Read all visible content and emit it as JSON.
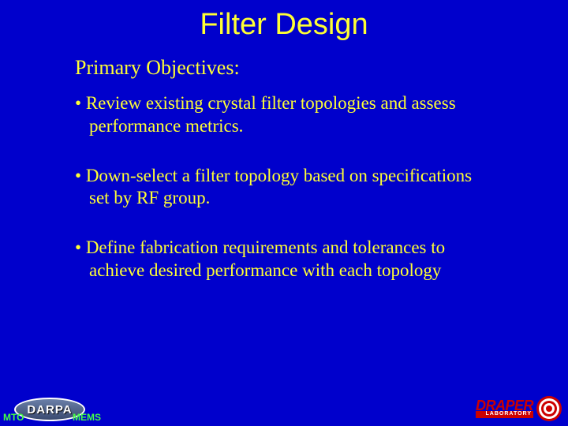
{
  "title": "Filter Design",
  "subtitle": "Primary Objectives:",
  "bullets": [
    {
      "line1": "Review existing crystal filter topologies and assess",
      "line2": "performance metrics."
    },
    {
      "line1": "Down-select a filter topology based on specifications",
      "line2": "set by RF group."
    },
    {
      "line1": "Define fabrication requirements and tolerances to",
      "line2": "achieve desired performance with each topology"
    }
  ],
  "footer": {
    "darpa": "DARPA",
    "mto": "MTO",
    "mems": "MEMS",
    "draper": "DRAPER",
    "draper_sub": "LABORATORY"
  }
}
